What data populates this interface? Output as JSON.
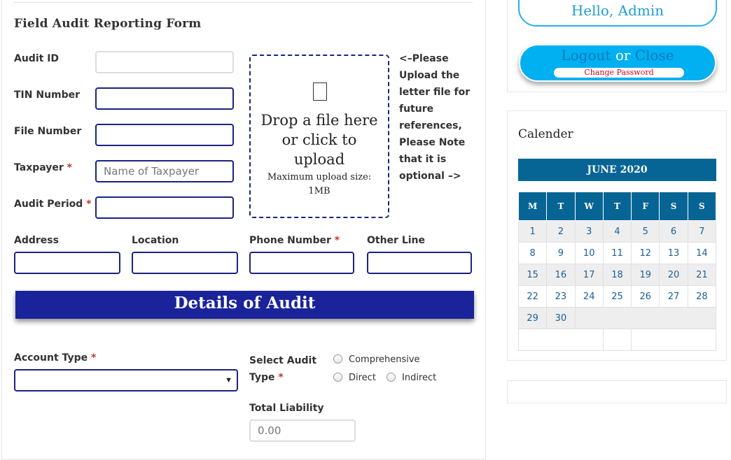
{
  "form": {
    "title": "Field Audit Reporting Form",
    "fields": {
      "audit_id": {
        "label": "Audit ID",
        "value": ""
      },
      "tin_number": {
        "label": "TIN Number",
        "value": ""
      },
      "file_number": {
        "label": "File Number",
        "value": ""
      },
      "taxpayer": {
        "label": "Taxpayer",
        "required_mark": "*",
        "placeholder": "Name of Taxpayer"
      },
      "audit_period": {
        "label": "Audit Period",
        "required_mark": "*",
        "value": ""
      },
      "address": {
        "label": "Address",
        "value": ""
      },
      "location": {
        "label": "Location",
        "value": ""
      },
      "phone_number": {
        "label": "Phone Number",
        "required_mark": "*",
        "value": ""
      },
      "other_line": {
        "label": "Other Line",
        "value": ""
      }
    },
    "upload": {
      "main_text": "Drop a file here or click to upload",
      "max_size_text": "Maximum upload size: 1MB",
      "note": "<–Please Upload the letter file for future references, Please Note that it is optional –>"
    },
    "section_title": "Details of Audit",
    "account_type": {
      "label": "Account Type",
      "required_mark": "*",
      "selected": ""
    },
    "audit_type": {
      "label_line1": "Select Audit",
      "label_line2": "Type",
      "required_mark": "*",
      "options": [
        "Comprehensive",
        "Direct",
        "Indirect"
      ]
    },
    "total_liability": {
      "label": "Total Liability",
      "placeholder": "0.00"
    }
  },
  "sidebar": {
    "greeting": "Hello, Admin",
    "logout": "Logout",
    "or": "or",
    "close": "Close",
    "change_password": "Change Password",
    "calendar": {
      "title": "Calender",
      "month": "JUNE 2020",
      "weekdays": [
        "M",
        "T",
        "W",
        "T",
        "F",
        "S",
        "S"
      ],
      "weeks": [
        [
          "1",
          "2",
          "3",
          "4",
          "5",
          "6",
          "7"
        ],
        [
          "8",
          "9",
          "10",
          "11",
          "12",
          "13",
          "14"
        ],
        [
          "15",
          "16",
          "17",
          "18",
          "19",
          "20",
          "21"
        ],
        [
          "22",
          "23",
          "24",
          "25",
          "26",
          "27",
          "28"
        ],
        [
          "29",
          "30"
        ]
      ]
    }
  },
  "colors": {
    "input_border": "#1a237e",
    "section_bar": "#1a2399",
    "calendar_header": "#076595",
    "accent_blue": "#00b0f0",
    "required": "#c0392b"
  }
}
